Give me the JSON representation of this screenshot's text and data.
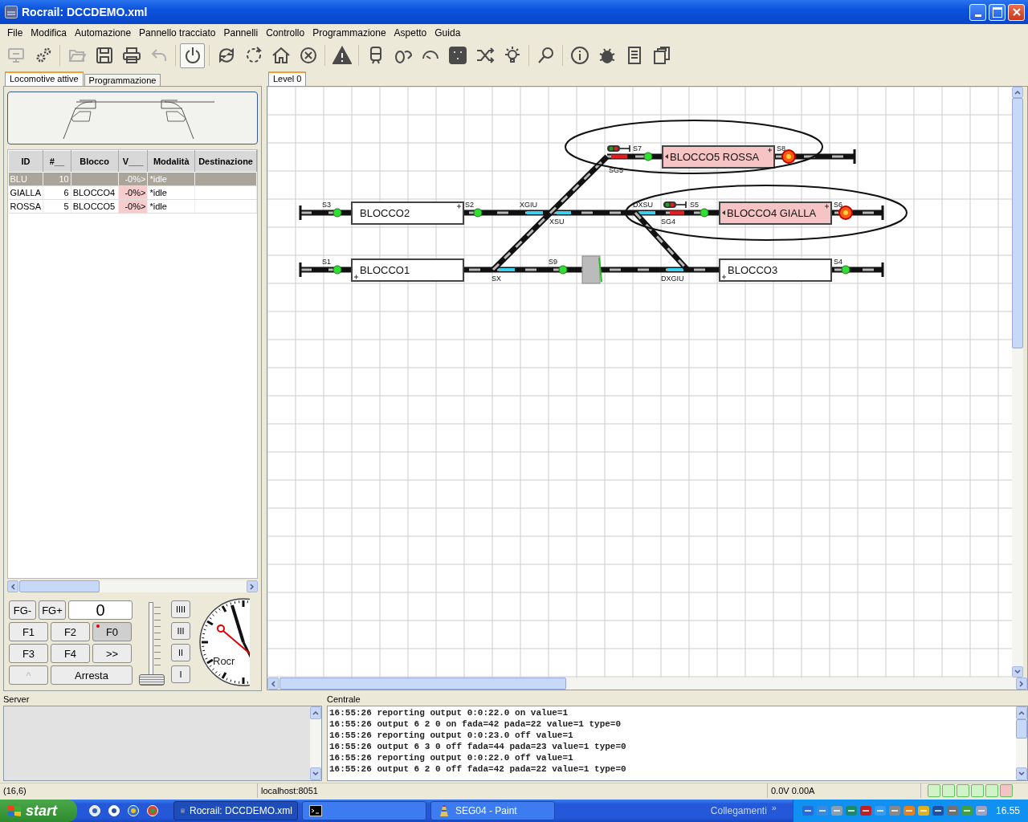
{
  "window": {
    "title": "Rocrail: DCCDEMO.xml"
  },
  "menu": [
    "File",
    "Modifica",
    "Automazione",
    "Pannello tracciato",
    "Pannelli",
    "Controllo",
    "Programmazione",
    "Aspetto",
    "Guida"
  ],
  "toolbar": [
    {
      "kind": "connect",
      "disabled": true,
      "pressed": false
    },
    {
      "kind": "settings",
      "disabled": false,
      "pressed": false
    },
    {
      "kind": "separator"
    },
    {
      "kind": "open",
      "disabled": true,
      "pressed": false
    },
    {
      "kind": "save",
      "disabled": false,
      "pressed": false
    },
    {
      "kind": "print",
      "disabled": false,
      "pressed": false
    },
    {
      "kind": "undo",
      "disabled": true,
      "pressed": false
    },
    {
      "kind": "separator"
    },
    {
      "kind": "power",
      "disabled": false,
      "pressed": true
    },
    {
      "kind": "separator"
    },
    {
      "kind": "sync",
      "disabled": false,
      "pressed": false
    },
    {
      "kind": "refresh",
      "disabled": false,
      "pressed": false
    },
    {
      "kind": "home",
      "disabled": false,
      "pressed": false
    },
    {
      "kind": "cancel",
      "disabled": false,
      "pressed": false
    },
    {
      "kind": "separator"
    },
    {
      "kind": "warning",
      "disabled": false,
      "pressed": false
    },
    {
      "kind": "separator"
    },
    {
      "kind": "train",
      "disabled": false,
      "pressed": false
    },
    {
      "kind": "mouse",
      "disabled": false,
      "pressed": false
    },
    {
      "kind": "gauge",
      "disabled": false,
      "pressed": false
    },
    {
      "kind": "network",
      "disabled": false,
      "pressed": false
    },
    {
      "kind": "shuffle",
      "disabled": false,
      "pressed": false
    },
    {
      "kind": "bulb",
      "disabled": false,
      "pressed": false
    },
    {
      "kind": "separator"
    },
    {
      "kind": "search",
      "disabled": false,
      "pressed": false
    },
    {
      "kind": "separator"
    },
    {
      "kind": "info",
      "disabled": false,
      "pressed": false
    },
    {
      "kind": "bug",
      "disabled": false,
      "pressed": false
    },
    {
      "kind": "list",
      "disabled": false,
      "pressed": false
    },
    {
      "kind": "pages",
      "disabled": false,
      "pressed": false
    }
  ],
  "left_tabs": [
    {
      "label": "Locomotive attive",
      "selected": true
    },
    {
      "label": "Programmazione",
      "selected": false
    }
  ],
  "locos": {
    "columns": [
      "ID",
      "#__",
      "Blocco",
      "V___",
      "Modalità",
      "Destinazione"
    ],
    "rows": [
      {
        "id": "BLU",
        "address": "10",
        "speed": "-0%>",
        "mode": "*idle",
        "selected": true
      },
      {
        "id": "GIALLA",
        "address": "6",
        "block": "BLOCCO4",
        "speed": "-0%>",
        "mode": "*idle",
        "selected": false
      },
      {
        "id": "ROSSA",
        "address": "5",
        "block": "BLOCCO5",
        "speed": "-0%>",
        "mode": "*idle",
        "selected": false
      }
    ]
  },
  "throttle": {
    "group_buttons": [
      "FG-",
      "FG+"
    ],
    "address": "0",
    "functions": [
      {
        "label": "F1",
        "on": false
      },
      {
        "label": "F2",
        "on": false
      },
      {
        "label": "F0",
        "on": true
      },
      {
        "label": "F3",
        "on": false
      },
      {
        "label": "F4",
        "on": false
      },
      {
        "label": ">>",
        "on": false
      }
    ],
    "direction": {
      "label": "^",
      "disabled": true
    },
    "stop": "Arresta",
    "speed": {
      "level": 0
    },
    "steps": [
      "IIII",
      "III",
      "II",
      "I"
    ],
    "clock_brand": "Rocr"
  },
  "plan": {
    "tabs": [
      {
        "label": "Level 0",
        "selected": true
      }
    ],
    "blocks": [
      {
        "label": "BLOCCO5 ROSSA",
        "occupied": true
      },
      {
        "label": "BLOCCO2",
        "occupied": false
      },
      {
        "label": "BLOCCO4 GIALLA",
        "occupied": true
      },
      {
        "label": "BLOCCO1",
        "occupied": false
      },
      {
        "label": "BLOCCO3",
        "occupied": false
      }
    ],
    "labels": [
      "S7",
      "S8",
      "SG5",
      "S3",
      "S2",
      "XGIU",
      "DXSU",
      "S5",
      "S6",
      "XSU",
      "SG4",
      "S1",
      "S9",
      "S4",
      "SX",
      "DXGIU"
    ]
  },
  "log": {
    "server_title": "Server",
    "central_title": "Centrale",
    "lines": [
      "16:55:26 reporting output 0:0:22.0 on value=1",
      "16:55:26 output 6 2 0 on fada=42 pada=22 value=1 type=0",
      "16:55:26 reporting output 0:0:23.0 off value=1",
      "16:55:26 output 6 3 0 off fada=44 pada=23 value=1 type=0",
      "16:55:26 reporting output 0:0:22.0 off value=1",
      "16:55:26 output 6 2 0 off fada=42 pada=22 value=1 type=0"
    ]
  },
  "status": {
    "position": "(16,6)",
    "host": "localhost:8051",
    "power": "0.0V 0.00A",
    "indicators": [
      {
        "color": "#d0f4c8"
      },
      {
        "color": "#d0f4c8"
      },
      {
        "color": "#d0f4c8"
      },
      {
        "color": "#d0f4c8"
      },
      {
        "color": "#d0f4c8"
      },
      {
        "color": "#f4c4c4"
      }
    ]
  },
  "taskbar": {
    "start": "start",
    "tasks": [
      {
        "kind": "app",
        "label": "Rocrail: DCCDEMO.xml",
        "selected": true
      },
      {
        "kind": "console",
        "selected": false
      },
      {
        "kind": "paint",
        "label": "SEG04 - Paint",
        "selected": false
      }
    ],
    "links": "Collegamenti",
    "links_more": "»",
    "clock": "16.55"
  }
}
